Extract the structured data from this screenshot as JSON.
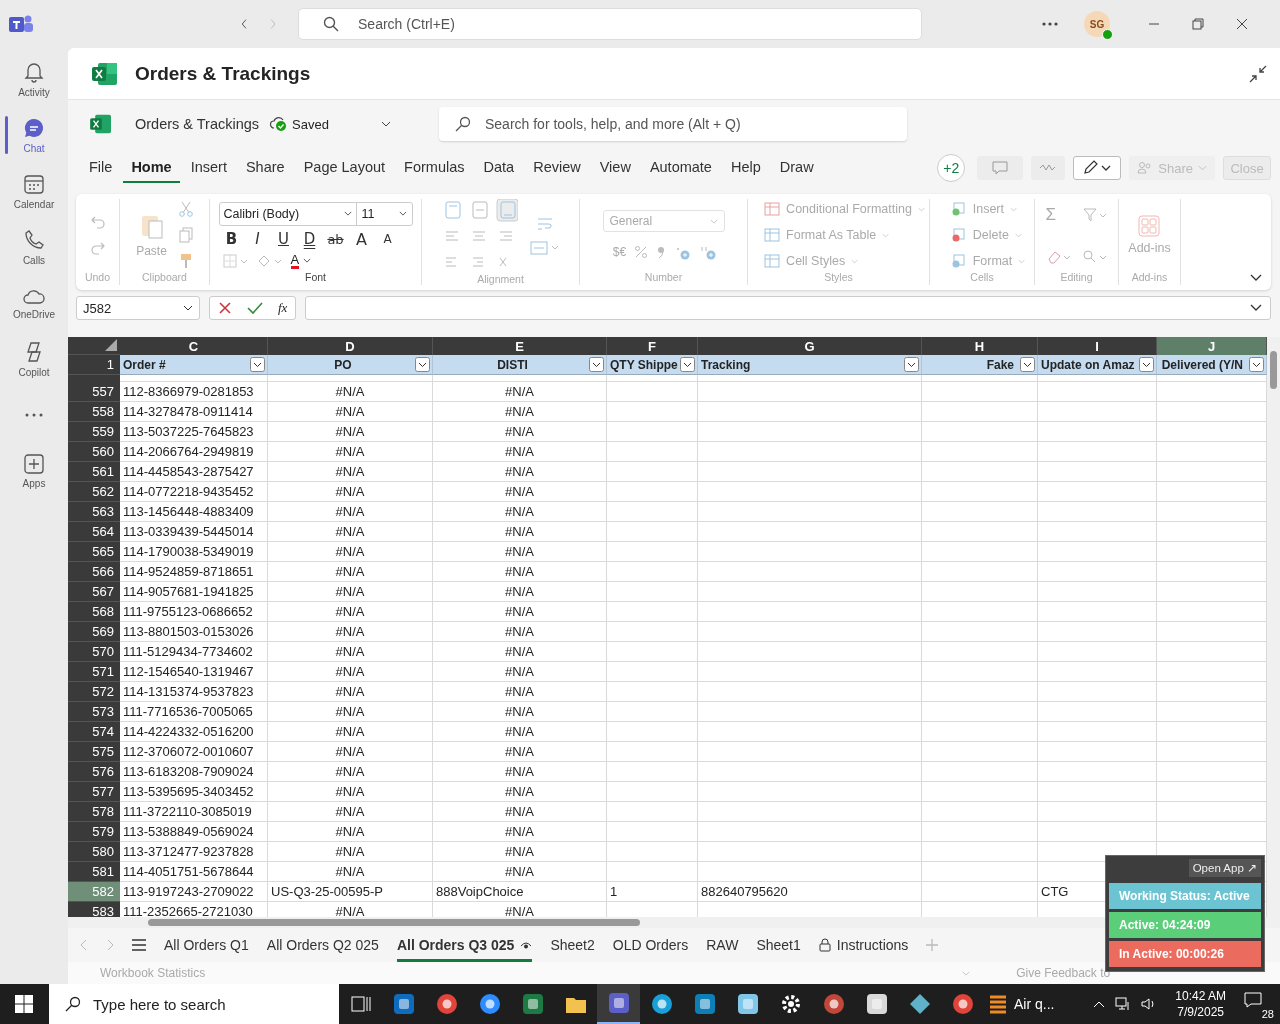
{
  "topbar": {
    "search_placeholder": "Search (Ctrl+E)",
    "avatar": "SG"
  },
  "rail": [
    {
      "label": "Activity",
      "kind": "bell",
      "selected": false
    },
    {
      "label": "Chat",
      "kind": "chat",
      "selected": true
    },
    {
      "label": "Calendar",
      "kind": "calendar",
      "selected": false
    },
    {
      "label": "Calls",
      "kind": "phone",
      "selected": false
    },
    {
      "label": "OneDrive",
      "kind": "cloud",
      "selected": false
    },
    {
      "label": "Copilot",
      "kind": "copilot",
      "selected": false
    },
    {
      "kind": "more",
      "selected": false
    },
    {
      "label": "Apps",
      "kind": "apps",
      "selected": false
    }
  ],
  "document_title": "Orders & Trackings",
  "workbook": {
    "file_name": "Orders & Trackings",
    "save_status": "Saved",
    "search_placeholder": "Search for tools, help, and more (Alt + Q)"
  },
  "menu_tabs": [
    {
      "label": "File",
      "selected": false
    },
    {
      "label": "Home",
      "selected": true
    },
    {
      "label": "Insert",
      "selected": false
    },
    {
      "label": "Share",
      "selected": false
    },
    {
      "label": "Page Layout",
      "selected": false
    },
    {
      "label": "Formulas",
      "selected": false
    },
    {
      "label": "Data",
      "selected": false
    },
    {
      "label": "Review",
      "selected": false
    },
    {
      "label": "View",
      "selected": false
    },
    {
      "label": "Automate",
      "selected": false
    },
    {
      "label": "Help",
      "selected": false
    },
    {
      "label": "Draw",
      "selected": false
    }
  ],
  "collaborators": "+2",
  "share_button": "Share",
  "close_button": "Close",
  "ribbon": {
    "undo": "Undo",
    "paste": "Paste",
    "clipboard": "Clipboard",
    "font_name": "Calibri (Body)",
    "font_size": "11",
    "font_buttons": [
      {
        "label": "B",
        "kind": "bold"
      },
      {
        "label": "I",
        "kind": "italic"
      },
      {
        "label": "U",
        "kind": "underline"
      },
      {
        "label": "D",
        "kind": "double"
      },
      {
        "label": "ab",
        "kind": "strike"
      },
      {
        "label": "A",
        "kind": "grow"
      },
      {
        "label": "A",
        "kind": "shrink"
      }
    ],
    "font_color_letter": "A",
    "font": "Font",
    "alignment": "Alignment",
    "number_format": "General",
    "currency": "$€",
    "number": "Number",
    "style_items": [
      "Conditional Formatting",
      "Format As Table",
      "Cell Styles"
    ],
    "styles": "Styles",
    "cell_items": [
      "Insert",
      "Delete",
      "Format"
    ],
    "cells": "Cells",
    "autosum": "Σ",
    "editing": "Editing",
    "addins_button": "Add-ins",
    "addins": "Add-ins"
  },
  "name_box": "J582",
  "fx": "fx",
  "columns": [
    {
      "letter": "C",
      "header": "Order #",
      "selected": false
    },
    {
      "letter": "D",
      "header": "PO",
      "selected": false
    },
    {
      "letter": "E",
      "header": "DISTI",
      "selected": false
    },
    {
      "letter": "F",
      "header": "QTY Shippe",
      "selected": false
    },
    {
      "letter": "G",
      "header": "Tracking",
      "selected": false
    },
    {
      "letter": "H",
      "header": "Fake",
      "selected": false
    },
    {
      "letter": "I",
      "header": "Update on Amaz",
      "selected": false
    },
    {
      "letter": "J",
      "header": "Delivered (Y/N",
      "selected": true
    }
  ],
  "header_row": "1",
  "rows": [
    {
      "n": "557",
      "selected": false,
      "cells": [
        "112-8366979-0281853",
        {
          "text": "#N/A",
          "kind": "error"
        },
        {
          "text": "#N/A",
          "kind": "error"
        },
        null,
        null,
        null,
        null,
        null
      ]
    },
    {
      "n": "558",
      "selected": false,
      "cells": [
        "114-3278478-0911414",
        {
          "text": "#N/A",
          "kind": "error"
        },
        {
          "text": "#N/A",
          "kind": "error"
        },
        null,
        null,
        null,
        null,
        null
      ]
    },
    {
      "n": "559",
      "selected": false,
      "cells": [
        "113-5037225-7645823",
        {
          "text": "#N/A",
          "kind": "error"
        },
        {
          "text": "#N/A",
          "kind": "error"
        },
        null,
        null,
        null,
        null,
        null
      ]
    },
    {
      "n": "560",
      "selected": false,
      "cells": [
        "114-2066764-2949819",
        {
          "text": "#N/A",
          "kind": "error"
        },
        {
          "text": "#N/A",
          "kind": "error"
        },
        null,
        null,
        null,
        null,
        null
      ]
    },
    {
      "n": "561",
      "selected": false,
      "cells": [
        "114-4458543-2875427",
        {
          "text": "#N/A",
          "kind": "error"
        },
        {
          "text": "#N/A",
          "kind": "error"
        },
        null,
        null,
        null,
        null,
        null
      ]
    },
    {
      "n": "562",
      "selected": false,
      "cells": [
        "114-0772218-9435452",
        {
          "text": "#N/A",
          "kind": "error"
        },
        {
          "text": "#N/A",
          "kind": "error"
        },
        null,
        null,
        null,
        null,
        null
      ]
    },
    {
      "n": "563",
      "selected": false,
      "cells": [
        "113-1456448-4883409",
        {
          "text": "#N/A",
          "kind": "error"
        },
        {
          "text": "#N/A",
          "kind": "error"
        },
        null,
        null,
        null,
        null,
        null
      ]
    },
    {
      "n": "564",
      "selected": false,
      "cells": [
        "113-0339439-5445014",
        {
          "text": "#N/A",
          "kind": "error"
        },
        {
          "text": "#N/A",
          "kind": "error"
        },
        null,
        null,
        null,
        null,
        null
      ]
    },
    {
      "n": "565",
      "selected": false,
      "cells": [
        "114-1790038-5349019",
        {
          "text": "#N/A",
          "kind": "error"
        },
        {
          "text": "#N/A",
          "kind": "error"
        },
        null,
        null,
        null,
        null,
        null
      ]
    },
    {
      "n": "566",
      "selected": false,
      "cells": [
        "114-9524859-8718651",
        {
          "text": "#N/A",
          "kind": "error"
        },
        {
          "text": "#N/A",
          "kind": "error"
        },
        null,
        null,
        null,
        null,
        null
      ]
    },
    {
      "n": "567",
      "selected": false,
      "cells": [
        "114-9057681-1941825",
        {
          "text": "#N/A",
          "kind": "error"
        },
        {
          "text": "#N/A",
          "kind": "error"
        },
        null,
        null,
        null,
        null,
        null
      ]
    },
    {
      "n": "568",
      "selected": false,
      "cells": [
        "111-9755123-0686652",
        {
          "text": "#N/A",
          "kind": "error"
        },
        {
          "text": "#N/A",
          "kind": "error"
        },
        null,
        null,
        null,
        null,
        null
      ]
    },
    {
      "n": "569",
      "selected": false,
      "cells": [
        "113-8801503-0153026",
        {
          "text": "#N/A",
          "kind": "error"
        },
        {
          "text": "#N/A",
          "kind": "error"
        },
        null,
        null,
        null,
        null,
        null
      ]
    },
    {
      "n": "570",
      "selected": false,
      "cells": [
        "111-5129434-7734602",
        {
          "text": "#N/A",
          "kind": "error"
        },
        {
          "text": "#N/A",
          "kind": "error"
        },
        null,
        null,
        null,
        null,
        null
      ]
    },
    {
      "n": "571",
      "selected": false,
      "cells": [
        "112-1546540-1319467",
        {
          "text": "#N/A",
          "kind": "error"
        },
        {
          "text": "#N/A",
          "kind": "error"
        },
        null,
        null,
        null,
        null,
        null
      ]
    },
    {
      "n": "572",
      "selected": false,
      "cells": [
        "114-1315374-9537823",
        {
          "text": "#N/A",
          "kind": "error"
        },
        {
          "text": "#N/A",
          "kind": "error"
        },
        null,
        null,
        null,
        null,
        null
      ]
    },
    {
      "n": "573",
      "selected": false,
      "cells": [
        "111-7716536-7005065",
        {
          "text": "#N/A",
          "kind": "error"
        },
        {
          "text": "#N/A",
          "kind": "error"
        },
        null,
        null,
        null,
        null,
        null
      ]
    },
    {
      "n": "574",
      "selected": false,
      "cells": [
        "114-4224332-0516200",
        {
          "text": "#N/A",
          "kind": "error"
        },
        {
          "text": "#N/A",
          "kind": "error"
        },
        null,
        null,
        null,
        null,
        null
      ]
    },
    {
      "n": "575",
      "selected": false,
      "cells": [
        "112-3706072-0010607",
        {
          "text": "#N/A",
          "kind": "error"
        },
        {
          "text": "#N/A",
          "kind": "error"
        },
        null,
        null,
        null,
        null,
        null
      ]
    },
    {
      "n": "576",
      "selected": false,
      "cells": [
        "113-6183208-7909024",
        {
          "text": "#N/A",
          "kind": "error"
        },
        {
          "text": "#N/A",
          "kind": "error"
        },
        null,
        null,
        null,
        null,
        null
      ]
    },
    {
      "n": "577",
      "selected": false,
      "cells": [
        "113-5395695-3403452",
        {
          "text": "#N/A",
          "kind": "error"
        },
        {
          "text": "#N/A",
          "kind": "error"
        },
        null,
        null,
        null,
        null,
        null
      ]
    },
    {
      "n": "578",
      "selected": false,
      "cells": [
        "111-3722110-3085019",
        {
          "text": "#N/A",
          "kind": "error"
        },
        {
          "text": "#N/A",
          "kind": "error"
        },
        null,
        null,
        null,
        null,
        null
      ]
    },
    {
      "n": "579",
      "selected": false,
      "cells": [
        "113-5388849-0569024",
        {
          "text": "#N/A",
          "kind": "error"
        },
        {
          "text": "#N/A",
          "kind": "error"
        },
        null,
        null,
        null,
        null,
        null
      ]
    },
    {
      "n": "580",
      "selected": false,
      "cells": [
        "113-3712477-9237828",
        {
          "text": "#N/A",
          "kind": "error"
        },
        {
          "text": "#N/A",
          "kind": "error"
        },
        null,
        null,
        null,
        null,
        null
      ]
    },
    {
      "n": "581",
      "selected": false,
      "cells": [
        "114-4051751-5678644",
        {
          "text": "#N/A",
          "kind": "error"
        },
        {
          "text": "#N/A",
          "kind": "error"
        },
        null,
        null,
        null,
        null,
        null
      ]
    },
    {
      "n": "582",
      "selected": true,
      "cells": [
        "113-9197243-2709022",
        "US-Q3-25-00595-P",
        "888VoipChoice",
        "1",
        "882640795620",
        null,
        "CTG",
        null
      ]
    },
    {
      "n": "583",
      "selected": false,
      "cells": [
        "111-2352665-2721030",
        {
          "text": "#N/A",
          "kind": "error"
        },
        {
          "text": "#N/A",
          "kind": "error"
        },
        null,
        null,
        null,
        null,
        null
      ]
    }
  ],
  "sheet_tabs": [
    {
      "label": "All Orders Q1",
      "kind": "plain",
      "selected": false
    },
    {
      "label": "All Orders Q2 025",
      "kind": "plain",
      "selected": false
    },
    {
      "label": "All Orders Q3 025",
      "kind": "sheet_view",
      "selected": true
    },
    {
      "label": "Sheet2",
      "kind": "plain",
      "selected": false
    },
    {
      "label": "OLD Orders",
      "kind": "plain",
      "selected": false
    },
    {
      "label": "RAW",
      "kind": "plain",
      "selected": false
    },
    {
      "label": "Sheet1",
      "kind": "plain",
      "selected": false
    },
    {
      "label": "Instructions",
      "kind": "protected",
      "selected": false
    }
  ],
  "status_bar": {
    "statistics": "Workbook Statistics",
    "feedback": "Give Feedback to"
  },
  "tracker": {
    "open_app": "Open App ↗",
    "status": "Working Status: Active",
    "active": "Active: 04:24:09",
    "inactive": "In Active: 00:00:26"
  },
  "taskbar": {
    "search_placeholder": "Type here to search",
    "app_label": "Air q...",
    "time": "10:42 AM",
    "date": "7/9/2025",
    "notifications": "28"
  }
}
